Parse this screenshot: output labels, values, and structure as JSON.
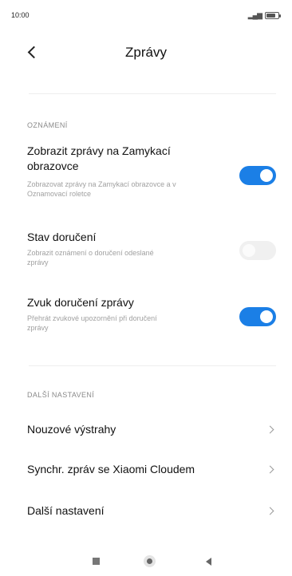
{
  "status_bar": {
    "time": "10:00",
    "signal_icon": "signal-icon",
    "battery_icon": "battery-icon"
  },
  "header": {
    "title": "Zprávy",
    "back_icon": "back-arrow-icon"
  },
  "notifications_section": {
    "header": "OZNÁMENÍ",
    "settings": [
      {
        "title_line1": "Zobrazit zprávy na Zamykací",
        "title_line2": "obrazovce",
        "desc_line1": "Zobrazovat zprávy na Zamykací obrazovce a v",
        "desc_line2": "Oznamovací roletce",
        "enabled": true
      },
      {
        "title_line1": "Stav doručení",
        "desc_line1": "Zobrazit oznámení o doručení odeslané",
        "desc_line2": "zprávy",
        "enabled": false
      },
      {
        "title_line1": "Zvuk doručení zprávy",
        "desc_line1": "Přehrát zvukové upozornění při doručení",
        "desc_line2": "zprávy",
        "enabled": true
      }
    ]
  },
  "more_section": {
    "header": "DALŠÍ NASTAVENÍ",
    "items": [
      {
        "label": "Nouzové výstrahy"
      },
      {
        "label": "Synchr. zpráv se Xiaomi Cloudem"
      },
      {
        "label": "Další nastavení"
      }
    ]
  },
  "colors": {
    "accent": "#1b7fe6",
    "toggle_off": "#f0f0f0",
    "secondary_text": "#a0a0a0"
  },
  "nav_bar": {
    "recents_icon": "square-recents-icon",
    "home_icon": "circle-home-icon",
    "back_icon": "triangle-back-icon"
  }
}
